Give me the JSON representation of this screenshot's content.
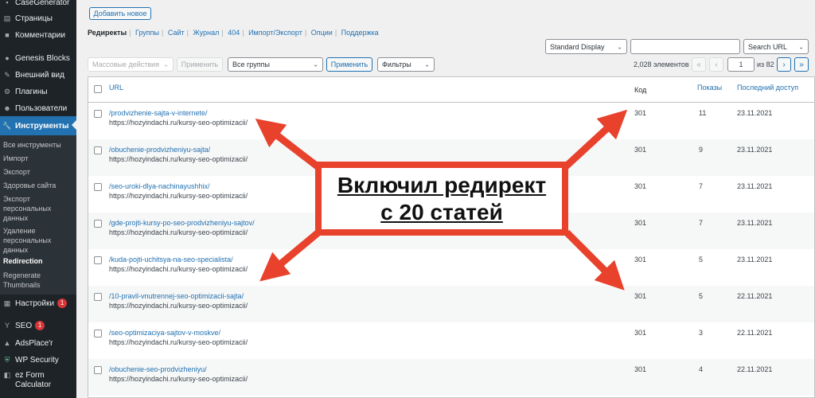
{
  "sidebar": {
    "items": [
      {
        "label": "CaseGenerator",
        "icon": "plugin-icon"
      },
      {
        "label": "Страницы",
        "icon": "pages-icon"
      },
      {
        "label": "Комментарии",
        "icon": "comments-icon"
      },
      {
        "label": "Genesis Blocks",
        "icon": "genesis-icon"
      },
      {
        "label": "Внешний вид",
        "icon": "brush-icon"
      },
      {
        "label": "Плагины",
        "icon": "plugins-icon"
      },
      {
        "label": "Пользователи",
        "icon": "users-icon"
      },
      {
        "label": "Инструменты",
        "icon": "wrench-icon",
        "active": true
      }
    ],
    "submenu": [
      {
        "label": "Все инструменты"
      },
      {
        "label": "Импорт"
      },
      {
        "label": "Экспорт"
      },
      {
        "label": "Здоровье сайта"
      },
      {
        "label": "Экспорт персональных данных"
      },
      {
        "label": "Удаление персональных данных"
      },
      {
        "label": "Redirection",
        "current": true
      },
      {
        "label": "Regenerate Thumbnails"
      }
    ],
    "bottom_items": [
      {
        "label": "Настройки",
        "badge": "1",
        "icon": "settings-icon"
      },
      {
        "label": "SEO",
        "badge": "1",
        "icon": "yoast-icon"
      },
      {
        "label": "AdsPlace'r",
        "icon": "ads-icon"
      },
      {
        "label": "WP Security",
        "icon": "shield-icon"
      },
      {
        "label": "ez Form Calculator",
        "icon": "form-icon"
      }
    ]
  },
  "header": {
    "add_new": "Добавить новое"
  },
  "subnav": [
    {
      "label": "Редиректы",
      "current": true
    },
    {
      "label": "Группы"
    },
    {
      "label": "Сайт"
    },
    {
      "label": "Журнал"
    },
    {
      "label": "404"
    },
    {
      "label": "Импорт/Экспорт"
    },
    {
      "label": "Опции"
    },
    {
      "label": "Поддержка"
    }
  ],
  "toolbar": {
    "display_select": "Standard Display",
    "search_placeholder": "",
    "search_button": "Search URL",
    "bulk_actions": "Массовые действия",
    "apply_disabled": "Применить",
    "groups_select": "Все группы",
    "apply": "Применить",
    "filters": "Фильтры",
    "count": "2,028 элементов",
    "page_value": "1",
    "page_of": "из 82"
  },
  "table": {
    "headers": {
      "url": "URL",
      "code": "Код",
      "hits": "Показы",
      "last": "Последний доступ"
    },
    "rows": [
      {
        "url": "/prodvizhenie-sajta-v-internete/",
        "target": "https://hozyindachi.ru/kursy-seo-optimizacii/",
        "code": "301",
        "hits": "11",
        "date": "23.11.2021"
      },
      {
        "url": "/obuchenie-prodvizheniyu-sajta/",
        "target": "https://hozyindachi.ru/kursy-seo-optimizacii/",
        "code": "301",
        "hits": "9",
        "date": "23.11.2021"
      },
      {
        "url": "/seo-uroki-dlya-nachinayushhix/",
        "target": "https://hozyindachi.ru/kursy-seo-optimizacii/",
        "code": "301",
        "hits": "7",
        "date": "23.11.2021"
      },
      {
        "url": "/gde-projti-kursy-po-seo-prodvizheniyu-sajtov/",
        "target": "https://hozyindachi.ru/kursy-seo-optimizacii/",
        "code": "301",
        "hits": "7",
        "date": "23.11.2021"
      },
      {
        "url": "/kuda-pojti-uchitsya-na-seo-specialista/",
        "target": "https://hozyindachi.ru/kursy-seo-optimizacii/",
        "code": "301",
        "hits": "5",
        "date": "23.11.2021"
      },
      {
        "url": "/10-pravil-vnutrennej-seo-optimizacii-sajta/",
        "target": "https://hozyindachi.ru/kursy-seo-optimizacii/",
        "code": "301",
        "hits": "5",
        "date": "22.11.2021"
      },
      {
        "url": "/seo-optimizaciya-sajtov-v-moskve/",
        "target": "https://hozyindachi.ru/kursy-seo-optimizacii/",
        "code": "301",
        "hits": "3",
        "date": "22.11.2021"
      },
      {
        "url": "/obuchenie-seo-prodvizheniyu/",
        "target": "https://hozyindachi.ru/kursy-seo-optimizacii/",
        "code": "301",
        "hits": "4",
        "date": "22.11.2021"
      }
    ]
  },
  "callout": {
    "line1": "Включил редирект",
    "line2": "с 20 статей"
  },
  "colors": {
    "accent": "#2271b1",
    "sidebar": "#1d2327",
    "callout": "#e8412c"
  }
}
